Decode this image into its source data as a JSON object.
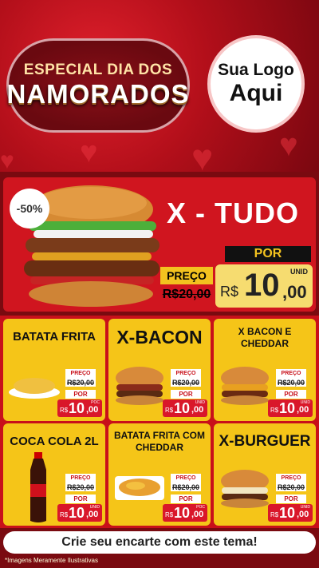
{
  "header": {
    "title_line1": "ESPECIAL DIA DOS",
    "title_line2": "NAMORADOS",
    "logo_line1": "Sua Logo",
    "logo_line2": "Aqui"
  },
  "featured": {
    "discount": "-50%",
    "name": "X - TUDO",
    "preco_label": "PREÇO",
    "old_price": "R$20,00",
    "por_label": "POR",
    "currency": "R$",
    "price_int": "10",
    "price_dec": ",00",
    "unit": "UNID"
  },
  "products": [
    {
      "name": "BATATA FRITA",
      "preco_label": "PREÇO",
      "old_price": "R$20,00",
      "por_label": "POR",
      "currency": "R$",
      "price_int": "10",
      "price_dec": ",00",
      "unit": "POC"
    },
    {
      "name": "X-BACON",
      "preco_label": "PREÇO",
      "old_price": "R$20,00",
      "por_label": "POR",
      "currency": "R$",
      "price_int": "10",
      "price_dec": ",00",
      "unit": "UNID"
    },
    {
      "name": "X BACON E CHEDDAR",
      "preco_label": "PREÇO",
      "old_price": "R$20,00",
      "por_label": "POR",
      "currency": "R$",
      "price_int": "10",
      "price_dec": ",00",
      "unit": "UNID"
    },
    {
      "name": "COCA COLA 2L",
      "preco_label": "PREÇO",
      "old_price": "R$20,00",
      "por_label": "POR",
      "currency": "R$",
      "price_int": "10",
      "price_dec": ",00",
      "unit": "UNID"
    },
    {
      "name": "BATATA FRITA COM CHEDDAR",
      "preco_label": "PREÇO",
      "old_price": "R$20,00",
      "por_label": "POR",
      "currency": "R$",
      "price_int": "10",
      "price_dec": ",00",
      "unit": "POC"
    },
    {
      "name": "X-BURGUER",
      "preco_label": "PREÇO",
      "old_price": "R$20,00",
      "por_label": "POR",
      "currency": "R$",
      "price_int": "10",
      "price_dec": ",00",
      "unit": "UNID"
    }
  ],
  "footer": {
    "cta": "Crie seu encarte com este tema!",
    "disclaimer": "*Imagens Meramente Ilustrativas"
  },
  "colors": {
    "red": "#d0151f",
    "yellow": "#f5c518",
    "dark_red": "#7a0710"
  }
}
